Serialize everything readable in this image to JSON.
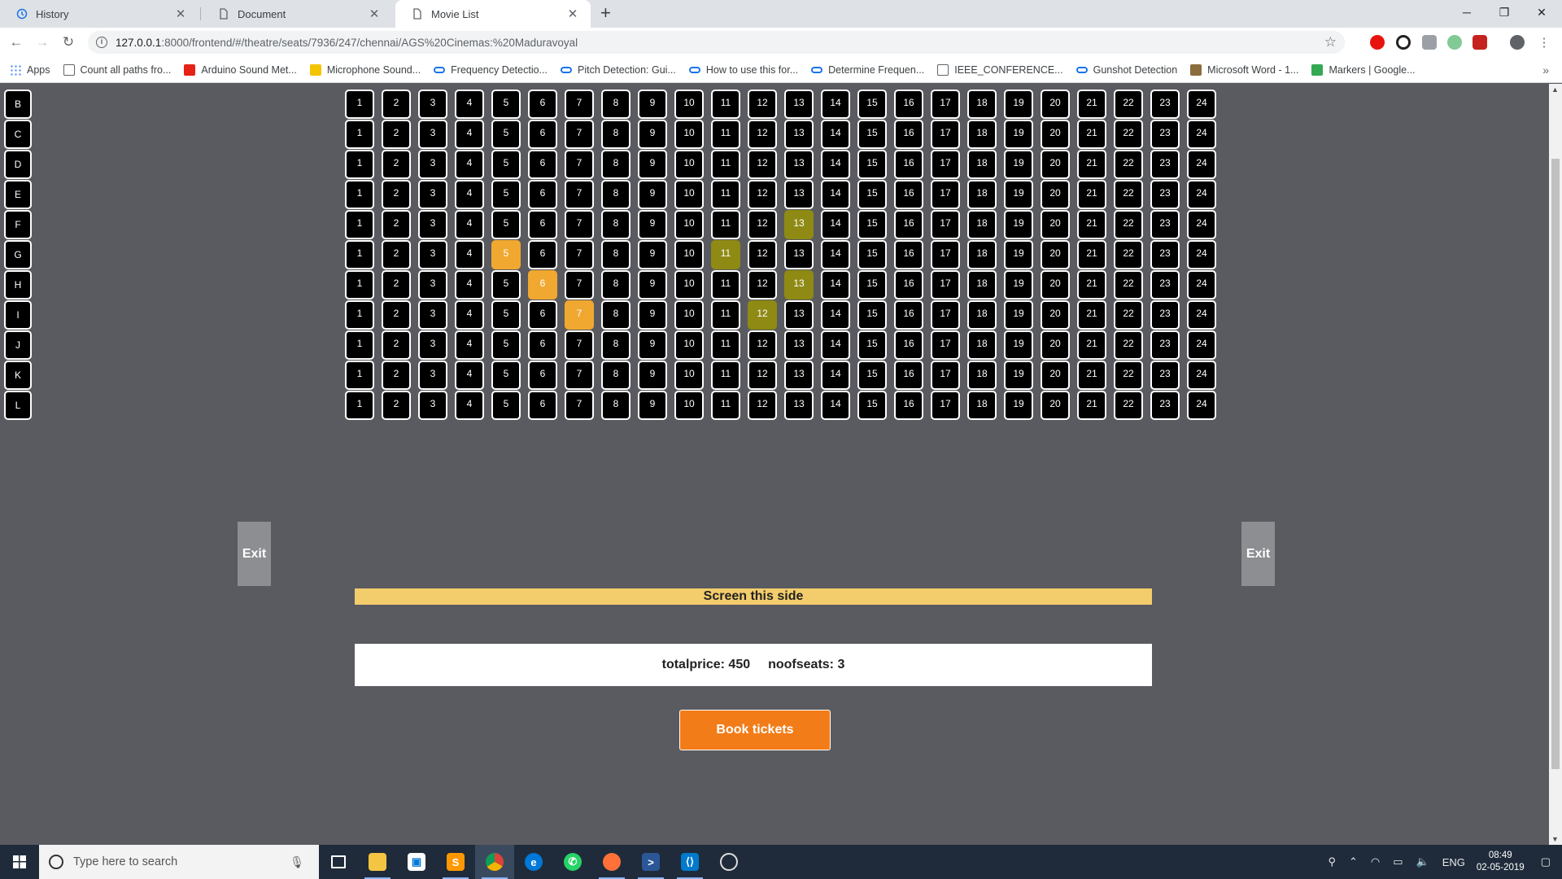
{
  "browser": {
    "tabs": [
      {
        "title": "History",
        "icon": "history-icon"
      },
      {
        "title": "Document",
        "icon": "document-icon"
      },
      {
        "title": "Movie List",
        "icon": "document-icon"
      }
    ],
    "active_tab": 2,
    "url_host": "127.0.0.1",
    "url_rest": ":8000/frontend/#/theatre/seats/7936/247/chennai/AGS%20Cinemas:%20Maduravoyal",
    "bookmarks": [
      {
        "label": "Apps",
        "icon": "apps-grid-icon",
        "color": "#1a73e8"
      },
      {
        "label": "Count all paths fro...",
        "icon": "page-icon",
        "color": "#ffffff"
      },
      {
        "label": "Arduino Sound Met...",
        "icon": "youtube-icon",
        "color": "#e62117"
      },
      {
        "label": "Microphone Sound...",
        "icon": "instructables-icon",
        "color": "#f4c400"
      },
      {
        "label": "Frequency Detectio...",
        "icon": "link-icon",
        "color": "#1a73e8"
      },
      {
        "label": "Pitch Detection: Gui...",
        "icon": "link-icon",
        "color": "#1a73e8"
      },
      {
        "label": "How to use this for...",
        "icon": "link-icon",
        "color": "#1a73e8"
      },
      {
        "label": "Determine Frequen...",
        "icon": "link-icon",
        "color": "#1a73e8"
      },
      {
        "label": "IEEE_CONFERENCE...",
        "icon": "page-icon",
        "color": "#ffffff"
      },
      {
        "label": "Gunshot Detection",
        "icon": "link-icon",
        "color": "#1a73e8"
      },
      {
        "label": "Microsoft Word - 1...",
        "icon": "word-icon",
        "color": "#8b6c3e"
      },
      {
        "label": "Markers | Google...",
        "icon": "code-icon",
        "color": "#34a853"
      }
    ]
  },
  "seating": {
    "rows": [
      "B",
      "C",
      "D",
      "E",
      "F",
      "G",
      "H",
      "I",
      "J",
      "K",
      "L"
    ],
    "seats_per_row": 24,
    "selected": [
      {
        "row": "G",
        "seat": 5
      },
      {
        "row": "H",
        "seat": 6
      },
      {
        "row": "I",
        "seat": 7
      }
    ],
    "booked": [
      {
        "row": "F",
        "seat": 13
      },
      {
        "row": "G",
        "seat": 11
      },
      {
        "row": "H",
        "seat": 13
      },
      {
        "row": "I",
        "seat": 12
      }
    ],
    "colors": {
      "available": "#000000",
      "selected": "#f0a830",
      "booked": "#8e8a14"
    }
  },
  "exit_left": "Exit",
  "exit_right": "Exit",
  "screen_label": "Screen this side",
  "summary": {
    "totalprice_label": "totalprice: 450",
    "noofseats_label": "noofseats: 3"
  },
  "book_button": "Book tickets",
  "taskbar": {
    "search_placeholder": "Type here to search",
    "lang": "ENG",
    "time": "08:49",
    "date": "02-05-2019"
  }
}
